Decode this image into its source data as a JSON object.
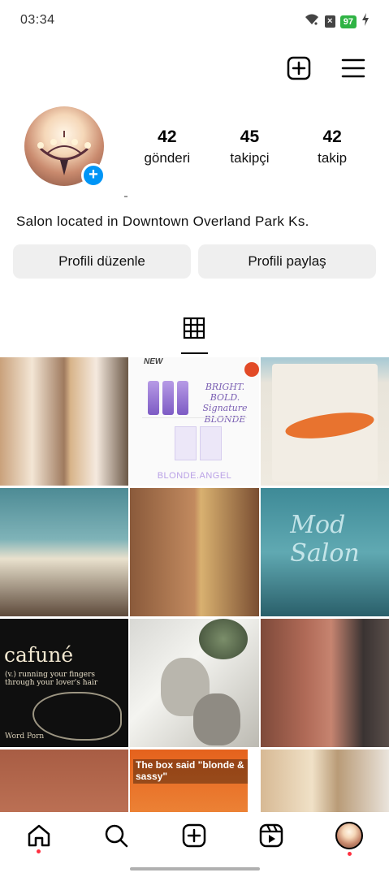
{
  "status_bar": {
    "time": "03:34",
    "battery": "97",
    "icons": [
      "wifi-icon",
      "no-sim-icon",
      "battery-icon",
      "charging-icon"
    ]
  },
  "header": {
    "icons": [
      "create-post-icon",
      "menu-icon"
    ]
  },
  "profile": {
    "avatar": "salon-chandelier-photo",
    "add_story_symbol": "+",
    "stats": [
      {
        "value": "42",
        "label": "gönderi"
      },
      {
        "value": "45",
        "label": "takipçi"
      },
      {
        "value": "42",
        "label": "takip"
      }
    ],
    "bio": "Salon located in Downtown Overland Park Ks."
  },
  "actions": {
    "edit_profile": "Profili düzenle",
    "share_profile": "Profili paylaş"
  },
  "tabs": {
    "active": "grid-icon"
  },
  "posts": [
    {
      "alt": "hair-color-before-after"
    },
    {
      "alt": "blonde-angel-product",
      "new_label": "NEW",
      "headline": "BRIGHT. BOLD. Signature BLONDE",
      "brand": "BLONDE.ANGEL"
    },
    {
      "alt": "salon-tote-bag"
    },
    {
      "alt": "salon-interior-collage"
    },
    {
      "alt": "short-haircut-collage"
    },
    {
      "alt": "salon-window-logo",
      "logo": "Mod Salon"
    },
    {
      "alt": "cafune-definition",
      "word": "cafuné",
      "definition": "(v.) running your fingers through your lover's hair",
      "footer": "Word Porn"
    },
    {
      "alt": "portrait-sketch"
    },
    {
      "alt": "red-hair-back"
    },
    {
      "alt": "red-hair-partial"
    },
    {
      "alt": "orange-hair-meme",
      "caption": "The box said \"blonde & sassy\""
    },
    {
      "alt": "blonde-waves"
    }
  ],
  "bottom_nav": {
    "items": [
      "home-icon",
      "search-icon",
      "create-icon",
      "reels-icon",
      "profile-avatar"
    ]
  }
}
